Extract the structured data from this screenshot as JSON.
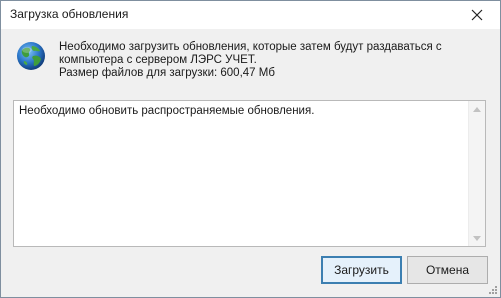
{
  "window": {
    "title": "Загрузка обновления"
  },
  "message": {
    "line1": "Необходимо загрузить обновления, которые затем будут раздаваться с",
    "line2": "компьютера с сервером ЛЭРС УЧЕТ.",
    "line3": "Размер файлов для загрузки: 600,47 Мб"
  },
  "details": {
    "text": "Необходимо обновить распространяемые обновления."
  },
  "buttons": {
    "download": "Загрузить",
    "cancel": "Отмена"
  },
  "icons": {
    "window_icon": "globe-icon",
    "close": "close-icon"
  },
  "colors": {
    "primary_border": "#3c7fb1",
    "primary_bg": "#e5f1fb"
  }
}
